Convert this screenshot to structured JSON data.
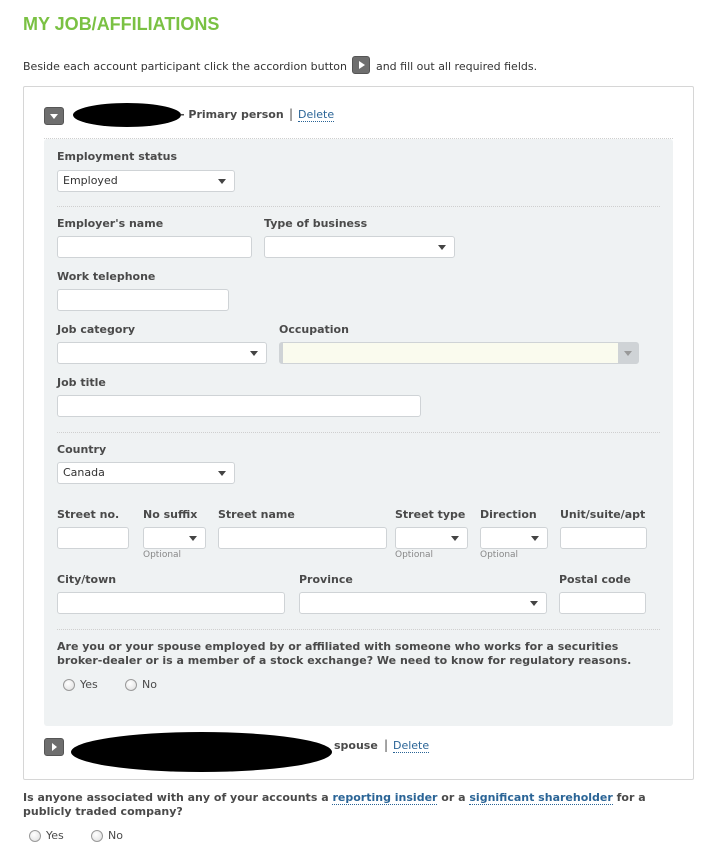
{
  "page": {
    "title": "MY JOB/AFFILIATIONS",
    "intro_before": "Beside each account participant click the accordion button",
    "intro_after": "and fill out all required fields.",
    "accent_color": "#7ac143"
  },
  "participants": [
    {
      "name_redacted": true,
      "role": "- Primary person",
      "separator": "|",
      "delete_label": "Delete",
      "expanded": true,
      "toggle_icon": "chevron-down-icon"
    },
    {
      "name_redacted": true,
      "role": "spouse",
      "separator": "|",
      "delete_label": "Delete",
      "expanded": false,
      "toggle_icon": "chevron-right-icon"
    }
  ],
  "form": {
    "employment_status": {
      "label": "Employment status",
      "value": "Employed"
    },
    "employer_name": {
      "label": "Employer's name",
      "value": ""
    },
    "type_of_business": {
      "label": "Type of business",
      "value": ""
    },
    "work_telephone": {
      "label": "Work telephone",
      "value": ""
    },
    "job_category": {
      "label": "Job category",
      "value": ""
    },
    "occupation": {
      "label": "Occupation",
      "value": "",
      "disabled": true
    },
    "job_title": {
      "label": "Job title",
      "value": ""
    },
    "country": {
      "label": "Country",
      "value": "Canada"
    },
    "street_no": {
      "label": "Street no.",
      "value": ""
    },
    "no_suffix": {
      "label": "No suffix",
      "value": "",
      "hint": "Optional"
    },
    "street_name": {
      "label": "Street name",
      "value": ""
    },
    "street_type": {
      "label": "Street type",
      "value": "",
      "hint": "Optional"
    },
    "direction": {
      "label": "Direction",
      "value": "",
      "hint": "Optional"
    },
    "unit": {
      "label": "Unit/suite/apt",
      "value": ""
    },
    "city": {
      "label": "City/town",
      "value": ""
    },
    "province": {
      "label": "Province",
      "value": ""
    },
    "postal_code": {
      "label": "Postal code",
      "value": ""
    },
    "affiliation_question": "Are you or your spouse employed by or affiliated with someone who works for a securities broker-dealer or is a member of a stock exchange? We need to know for regulatory reasons.",
    "affiliation_yes": "Yes",
    "affiliation_no": "No"
  },
  "insider": {
    "q_part1": "Is anyone associated with any of your accounts a",
    "link1": "reporting insider",
    "q_part2": "or a",
    "link2": "significant shareholder",
    "q_part3": "for a publicly traded company?",
    "yes": "Yes",
    "no": "No"
  }
}
